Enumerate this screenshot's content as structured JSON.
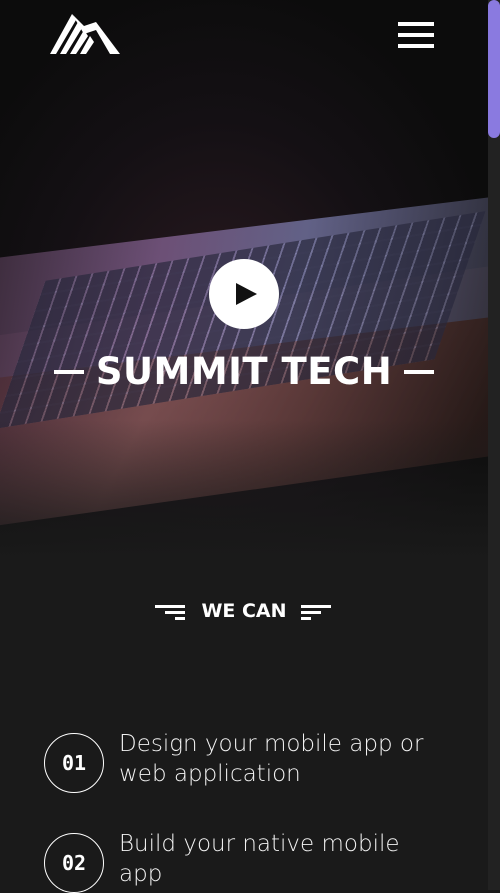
{
  "hero": {
    "title": "SUMMIT TECH"
  },
  "section": {
    "heading": "WE CAN"
  },
  "services": [
    {
      "number": "01",
      "text": "Design your mobile app or web application"
    },
    {
      "number": "02",
      "text": "Build your native mobile app"
    }
  ],
  "icons": {
    "logo": "mountain-logo-icon",
    "menu": "hamburger-menu-icon",
    "play": "play-icon"
  },
  "colors": {
    "background": "#1a1a1a",
    "text": "#ffffff",
    "scrollbar_thumb": "#8a7ae0"
  }
}
